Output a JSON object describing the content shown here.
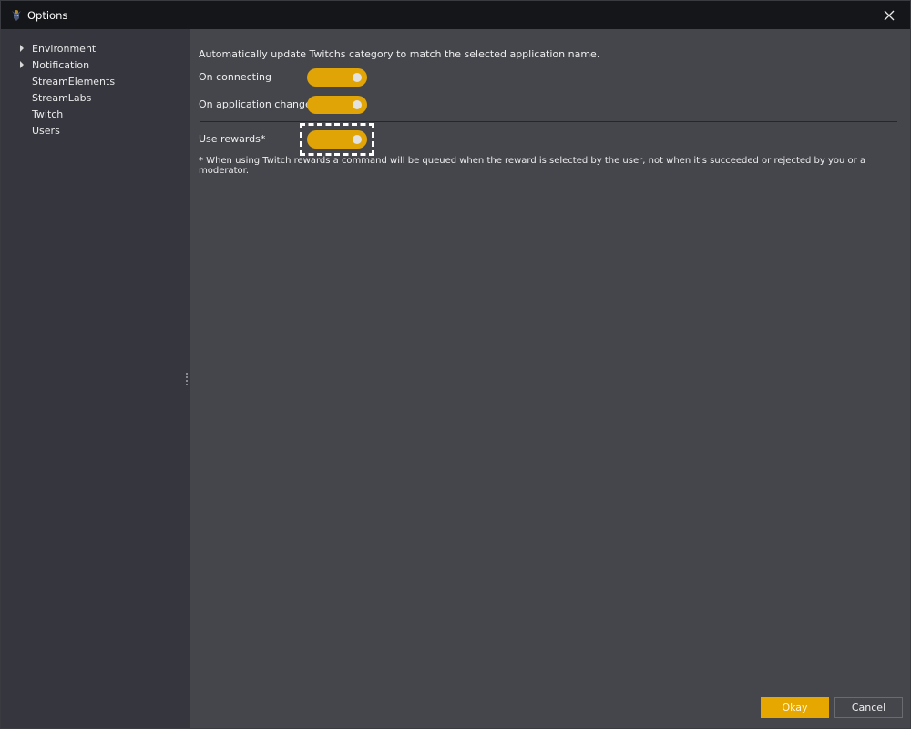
{
  "window": {
    "title": "Options",
    "icon": "app-logo-icon",
    "close_icon": "close-icon"
  },
  "sidebar": {
    "items": [
      {
        "label": "Environment",
        "expandable": true
      },
      {
        "label": "Notification",
        "expandable": true
      },
      {
        "label": "StreamElements",
        "expandable": false
      },
      {
        "label": "StreamLabs",
        "expandable": false
      },
      {
        "label": "Twitch",
        "expandable": false
      },
      {
        "label": "Users",
        "expandable": false
      }
    ]
  },
  "content": {
    "description": "Automatically update Twitchs category to match the selected application name.",
    "settings": [
      {
        "label": "On connecting",
        "enabled": true
      },
      {
        "label": "On application changed",
        "enabled": true
      },
      {
        "label": "Use rewards*",
        "enabled": true,
        "focused": true
      }
    ],
    "note": "* When using Twitch rewards a command will be queued when the reward is selected by the user, not when it's succeeded or rejected by you or a moderator."
  },
  "footer": {
    "okay_label": "Okay",
    "cancel_label": "Cancel"
  },
  "colors": {
    "accent": "#e0a407",
    "title_bar": "#15161a",
    "sidebar": "#36373e",
    "content": "#45464c"
  }
}
